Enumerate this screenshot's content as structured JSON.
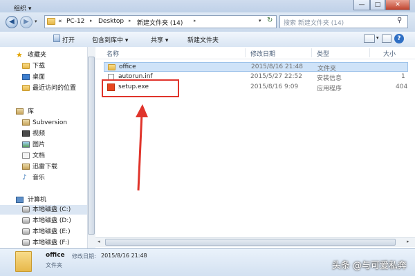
{
  "address": {
    "crumbs": [
      "«",
      "PC-12",
      "Desktop",
      "新建文件夹 (14)"
    ],
    "search_placeholder": "搜索 新建文件夹 (14)"
  },
  "toolbar": {
    "organize": "组织 ▾",
    "open": "打开",
    "include_in_library": "包含到库中 ▾",
    "share": "共享 ▾",
    "new_folder": "新建文件夹"
  },
  "sidebar": {
    "favorites": {
      "label": "收藏夹",
      "items": [
        "下载",
        "桌面",
        "最近访问的位置"
      ]
    },
    "libraries": {
      "label": "库",
      "items": [
        "Subversion",
        "视频",
        "图片",
        "文档",
        "迅雷下载",
        "音乐"
      ]
    },
    "computer": {
      "label": "计算机",
      "items": [
        "本地磁盘 (C:)",
        "本地磁盘 (D:)",
        "本地磁盘 (E:)",
        "本地磁盘 (F:)"
      ]
    }
  },
  "columns": [
    "名称",
    "修改日期",
    "类型",
    "大小"
  ],
  "files": [
    {
      "name": "office",
      "date": "2015/8/16 21:48",
      "type": "文件夹",
      "size": "",
      "icon": "folder-icon",
      "selected": true
    },
    {
      "name": "autorun.inf",
      "date": "2015/5/27 22:52",
      "type": "安装信息",
      "size": "1",
      "icon": "inf-file-icon",
      "selected": false
    },
    {
      "name": "setup.exe",
      "date": "2015/8/16 9:09",
      "type": "应用程序",
      "size": "404",
      "icon": "office-app-icon",
      "selected": false
    }
  ],
  "details": {
    "name": "office",
    "date_label": "修改日期:",
    "date": "2015/8/16 21:48",
    "type": "文件夹"
  },
  "watermark": "头条 @与可爱私奔",
  "colors": {
    "highlight_box": "#e0342b",
    "selection": "#cfe3f8"
  }
}
